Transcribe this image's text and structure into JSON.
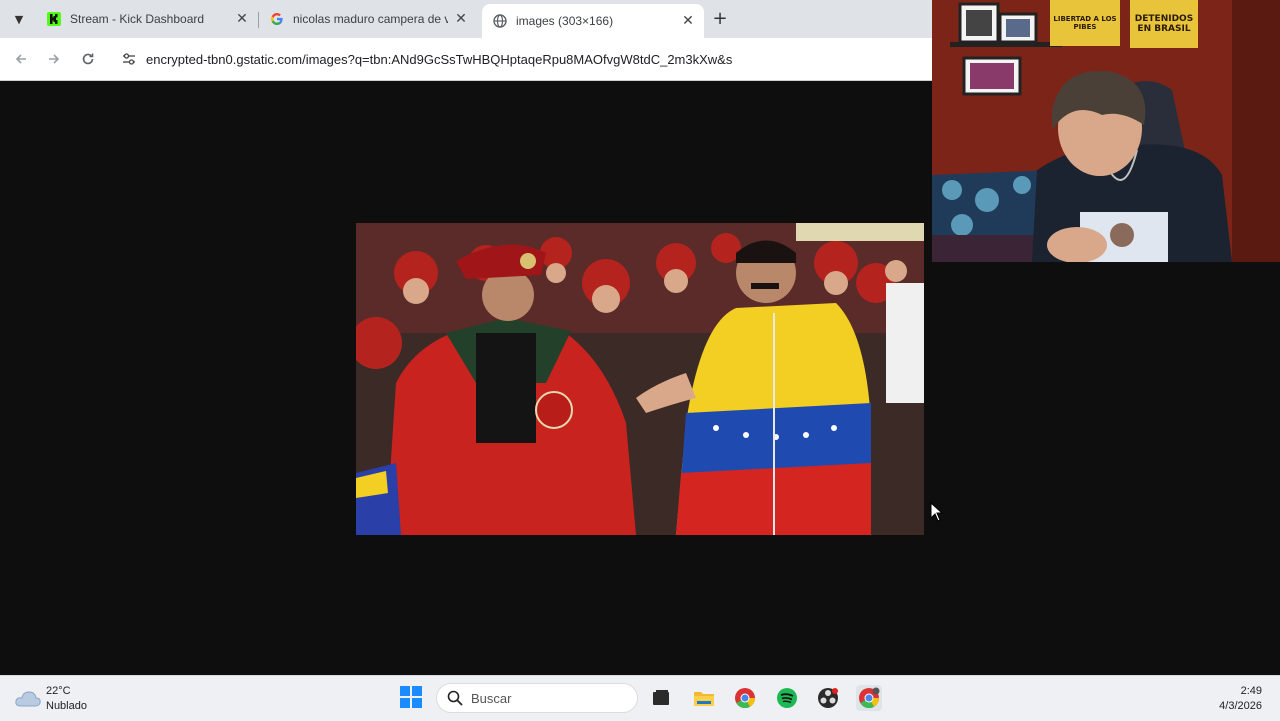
{
  "browser": {
    "tabs": [
      {
        "title": "Stream - Kick Dashboard",
        "icon": "kick-logo-icon",
        "active": false
      },
      {
        "title": "nicolas maduro campera de ve",
        "icon": "google-logo-icon",
        "active": false
      },
      {
        "title": "images (303×166)",
        "icon": "globe-icon",
        "active": true
      }
    ],
    "new_tab": "+",
    "close_glyph": "✕",
    "url": "encrypted-tbn0.gstatic.com/images?q=tbn:ANd9GcSsTwHBQHptaqeRpu8MAOfvgW8tdC_2m3kXw&s"
  },
  "webcam": {
    "sign_left": "LIBERTAD A LOS PIBES",
    "sign_right": "DETENIDOS EN BRASIL"
  },
  "taskbar": {
    "temperature": "22°C",
    "condition": "Nublado",
    "search_placeholder": "Buscar",
    "time": "2:49",
    "date": "4/3/2026"
  },
  "colors": {
    "kick_green": "#53fc18",
    "tabbar_bg": "#dfe3e8",
    "page_bg": "#0e0e0e",
    "taskbar_bg": "#eef0f3"
  }
}
